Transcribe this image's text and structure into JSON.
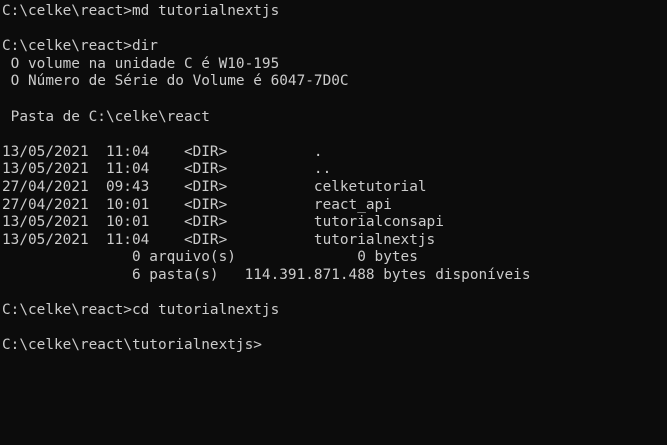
{
  "terminal": {
    "lines": [
      "C:\\celke\\react>md tutorialnextjs",
      "",
      "C:\\celke\\react>dir",
      " O volume na unidade C é W10-195",
      " O Número de Série do Volume é 6047-7D0C",
      "",
      " Pasta de C:\\celke\\react",
      "",
      "13/05/2021  11:04    <DIR>          .",
      "13/05/2021  11:04    <DIR>          ..",
      "27/04/2021  09:43    <DIR>          celketutorial",
      "27/04/2021  10:01    <DIR>          react_api",
      "13/05/2021  10:01    <DIR>          tutorialconsapi",
      "13/05/2021  11:04    <DIR>          tutorialnextjs",
      "               0 arquivo(s)              0 bytes",
      "               6 pasta(s)   114.391.871.488 bytes disponíveis",
      "",
      "C:\\celke\\react>cd tutorialnextjs",
      "",
      "C:\\celke\\react\\tutorialnextjs>"
    ]
  }
}
